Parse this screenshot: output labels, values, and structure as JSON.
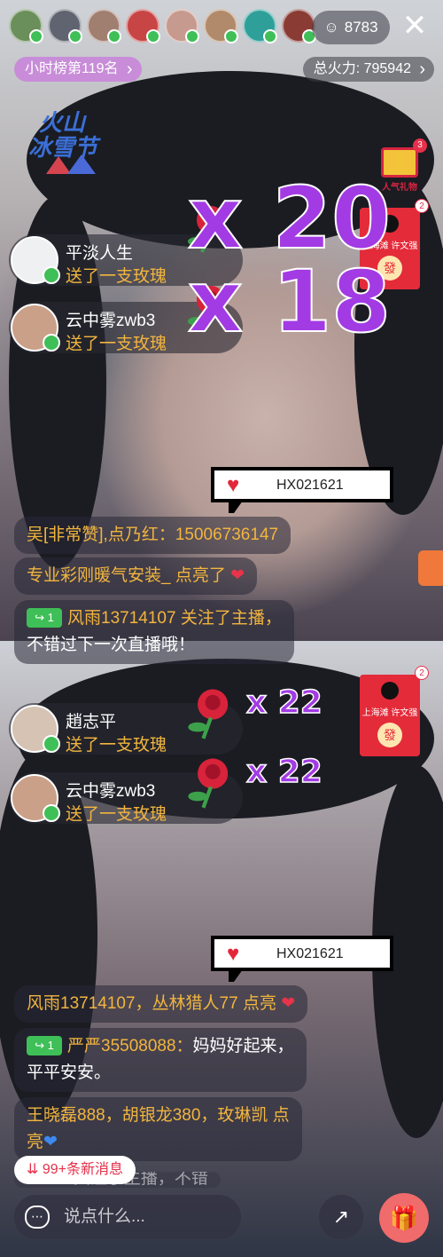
{
  "header": {
    "viewer_count": "8783",
    "rank_label": "小时榜第119名",
    "fire_label": "总火力: 795942"
  },
  "festival": {
    "line1": "火山",
    "line2": "冰雪节"
  },
  "gift_chest": {
    "label": "人气礼物",
    "count": "3"
  },
  "envelope": {
    "who": "上海滩 许文强",
    "button": "發",
    "count": "2"
  },
  "top_panel": {
    "gifts": [
      {
        "name": "平淡人生",
        "action": "送了一支玫瑰",
        "combo": "x 20"
      },
      {
        "name": "云中雾zwb3",
        "action": "送了一支玫瑰",
        "combo": "x 18"
      }
    ],
    "speech_code": "HX021621",
    "chat": {
      "line1": "吴[非常赞],点乃红：15006736147",
      "line2_text": "专业彩刚暖气安装_ 点亮了",
      "line3_level": "1",
      "line3_a": "风雨13714107 关注了主播，",
      "line3_b": "不错过下一次直播哦！"
    }
  },
  "bottom_panel": {
    "gifts": [
      {
        "name": "趙志平",
        "action": "送了一支玫瑰",
        "combo": "x 22"
      },
      {
        "name": "云中雾zwb3",
        "action": "送了一支玫瑰",
        "combo": "x 22"
      }
    ],
    "speech_code": "HX021621",
    "chat": {
      "line1": "风雨13714107，丛林猎人77 点亮",
      "line2_level": "1",
      "line2_name": "严严35508088：",
      "line2_text": "妈妈好起来，",
      "line2_b": "平平安安。",
      "line3_a": "王晓磊888，胡银龙380，玫琳凯 点",
      "line3_b": "亮"
    },
    "partial_line": "...213 关注了主播，不错"
  },
  "footer": {
    "new_messages": "99+条新消息",
    "input_placeholder": "说点什么..."
  },
  "colors": {
    "accent_yellow": "#f2b53e",
    "combo_purple": "#a23be4",
    "level_green": "#3fbf57",
    "alert_red": "#e6304a"
  }
}
